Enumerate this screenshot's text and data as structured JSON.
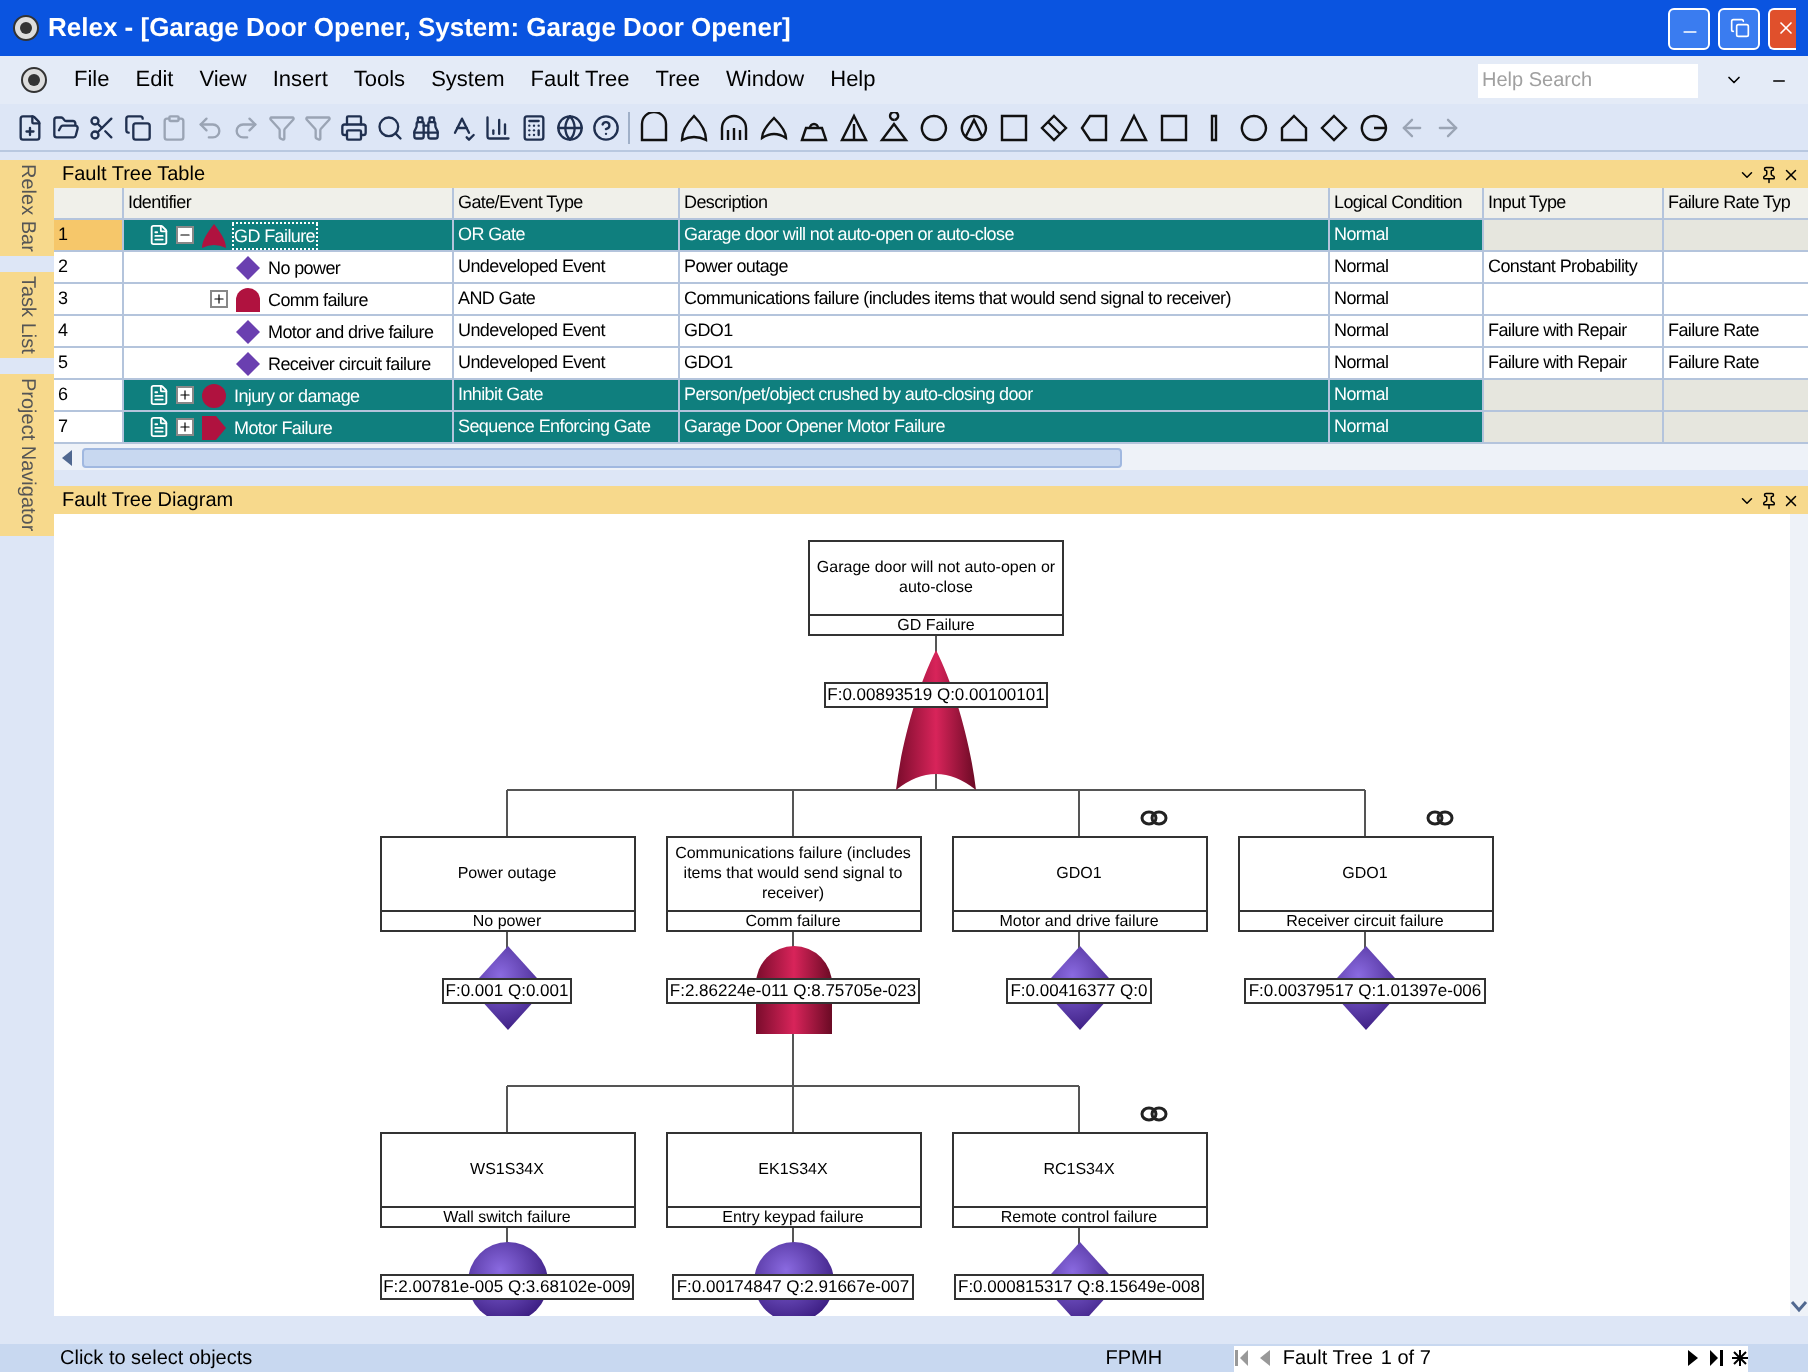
{
  "window": {
    "title": "Relex - [Garage Door Opener, System: Garage Door Opener]"
  },
  "menu": [
    "File",
    "Edit",
    "View",
    "Insert",
    "Tools",
    "System",
    "Fault Tree",
    "Tree",
    "Window",
    "Help"
  ],
  "help_search": {
    "placeholder": "Help Search"
  },
  "side_tabs": [
    "Relex Bar",
    "Task List",
    "Project Navigator"
  ],
  "table_panel": {
    "title": "Fault Tree Table",
    "columns": [
      "Identifier",
      "Gate/Event Type",
      "Description",
      "Logical Condition",
      "Input Type",
      "Failure Rate Typ"
    ],
    "rows": [
      {
        "number": "1",
        "identifier": "GD Failure",
        "kind": "or",
        "type": "OR Gate",
        "description": "Garage door will not auto-open or auto-close",
        "condition": "Normal",
        "highlighted": true,
        "selected": true,
        "expanded": true,
        "children": [
          {
            "number": "2",
            "identifier": "No power",
            "kind": "undeveloped",
            "type": "Undeveloped Event",
            "description": "Power outage",
            "condition": "Normal",
            "input_type": "Constant Probability",
            "highlighted": false,
            "selected": false
          },
          {
            "number": "3",
            "identifier": "Comm failure",
            "kind": "and",
            "type": "AND Gate",
            "description": "Communications failure (includes items that would send signal to receiver)",
            "condition": "Normal",
            "highlighted": false,
            "selected": false,
            "expanded": false
          },
          {
            "number": "4",
            "identifier": "Motor and drive failure",
            "kind": "undeveloped",
            "type": "Undeveloped Event",
            "description": "GDO1",
            "condition": "Normal",
            "input_type": "Failure with Repair",
            "rate_type": "Failure Rate",
            "highlighted": false,
            "selected": false
          },
          {
            "number": "5",
            "identifier": "Receiver circuit failure",
            "kind": "undeveloped",
            "type": "Undeveloped Event",
            "description": "GDO1",
            "condition": "Normal",
            "input_type": "Failure with Repair",
            "rate_type": "Failure Rate",
            "highlighted": false,
            "selected": false
          }
        ]
      },
      {
        "number": "6",
        "identifier": "Injury or damage",
        "kind": "inhibit",
        "type": "Inhibit Gate",
        "description": "Person/pet/object crushed by auto-closing door",
        "condition": "Normal",
        "highlighted": true,
        "selected": false,
        "expanded": false
      },
      {
        "number": "7",
        "identifier": "Motor Failure",
        "kind": "sequence",
        "type": "Sequence Enforcing Gate",
        "description": "Garage Door Opener Motor Failure",
        "condition": "Normal",
        "highlighted": true,
        "selected": false,
        "expanded": false
      }
    ]
  },
  "diagram_panel": {
    "title": "Fault Tree Diagram",
    "tree": {
      "description": "Garage door will not auto-open or auto-close",
      "label": "GD Failure",
      "kind": "or",
      "values": "F:0.00893519 Q:0.00100101",
      "linked": false,
      "children": [
        {
          "description": "Power outage",
          "label": "No power",
          "kind": "undeveloped",
          "values": "F:0.001 Q:0.001",
          "linked": false
        },
        {
          "description": "Communications failure (includes items that would send signal to receiver)",
          "label": "Comm failure",
          "kind": "and",
          "values": "F:2.86224e-011 Q:8.75705e-023",
          "linked": false,
          "children": [
            {
              "description": "WS1S34X",
              "label": "Wall switch failure",
              "kind": "basic",
              "values": "F:2.00781e-005 Q:3.68102e-009",
              "linked": false
            },
            {
              "description": "EK1S34X",
              "label": "Entry keypad failure",
              "kind": "basic",
              "values": "F:0.00174847 Q:2.91667e-007",
              "linked": false
            },
            {
              "description": "RC1S34X",
              "label": "Remote control failure",
              "kind": "undeveloped",
              "values": "F:0.000815317 Q:8.15649e-008",
              "linked": true
            }
          ]
        },
        {
          "description": "GDO1",
          "label": "Motor and drive failure",
          "kind": "undeveloped",
          "values": "F:0.00416377 Q:0",
          "linked": true
        },
        {
          "description": "GDO1",
          "label": "Receiver circuit failure",
          "kind": "undeveloped",
          "values": "F:0.00379517 Q:1.01397e-006",
          "linked": true
        }
      ]
    }
  },
  "status_bar": {
    "message": "Click to select objects",
    "units": "FPMH",
    "navigator": {
      "label": "Fault Tree",
      "position": "1 of 7"
    }
  }
}
